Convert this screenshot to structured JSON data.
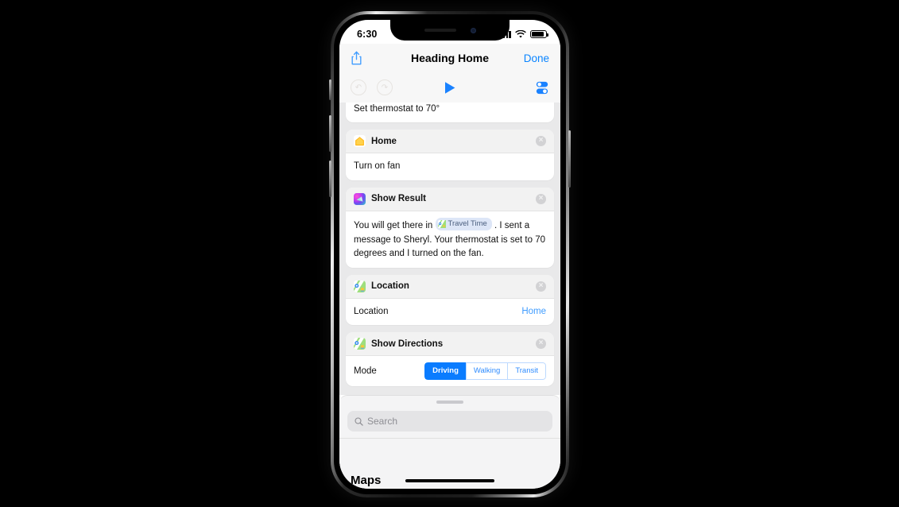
{
  "status_bar": {
    "time": "6:30",
    "signal_icon": "cellular-bars-icon",
    "wifi_icon": "wifi-icon",
    "battery_icon": "battery-icon"
  },
  "nav": {
    "share_icon": "share-icon",
    "title": "Heading Home",
    "done_label": "Done"
  },
  "toolbar": {
    "undo_icon": "undo-icon",
    "redo_icon": "redo-icon",
    "play_icon": "play-icon",
    "settings_icon": "settings-toggles-icon"
  },
  "accent_color": "#0a84ff",
  "actions": [
    {
      "id": "thermostat",
      "clipped": true,
      "body_text": "Set thermostat to 70°"
    },
    {
      "id": "home",
      "icon": "home-app-icon",
      "title": "Home",
      "close_icon": "close-icon",
      "body_text": "Turn on fan"
    },
    {
      "id": "show-result",
      "icon": "siri-shortcuts-icon",
      "title": "Show Result",
      "close_icon": "close-icon",
      "text_before": "You will get there in",
      "token": {
        "icon": "maps-icon",
        "label": "Travel Time"
      },
      "text_after": ". I sent a message to Sheryl. Your thermostat is set to 70 degrees and I turned on the fan."
    },
    {
      "id": "location",
      "icon": "maps-app-icon",
      "title": "Location",
      "close_icon": "close-icon",
      "row_label": "Location",
      "row_value": "Home"
    },
    {
      "id": "show-directions",
      "icon": "maps-app-icon",
      "title": "Show Directions",
      "close_icon": "close-icon",
      "row_label": "Mode",
      "mode_options": [
        "Driving",
        "Walking",
        "Transit"
      ],
      "mode_selected": "Driving"
    }
  ],
  "sheet": {
    "grabber": "sheet-grabber",
    "search_icon": "search-icon",
    "search_placeholder": "Search",
    "search_value": "",
    "app_label": "Maps"
  }
}
